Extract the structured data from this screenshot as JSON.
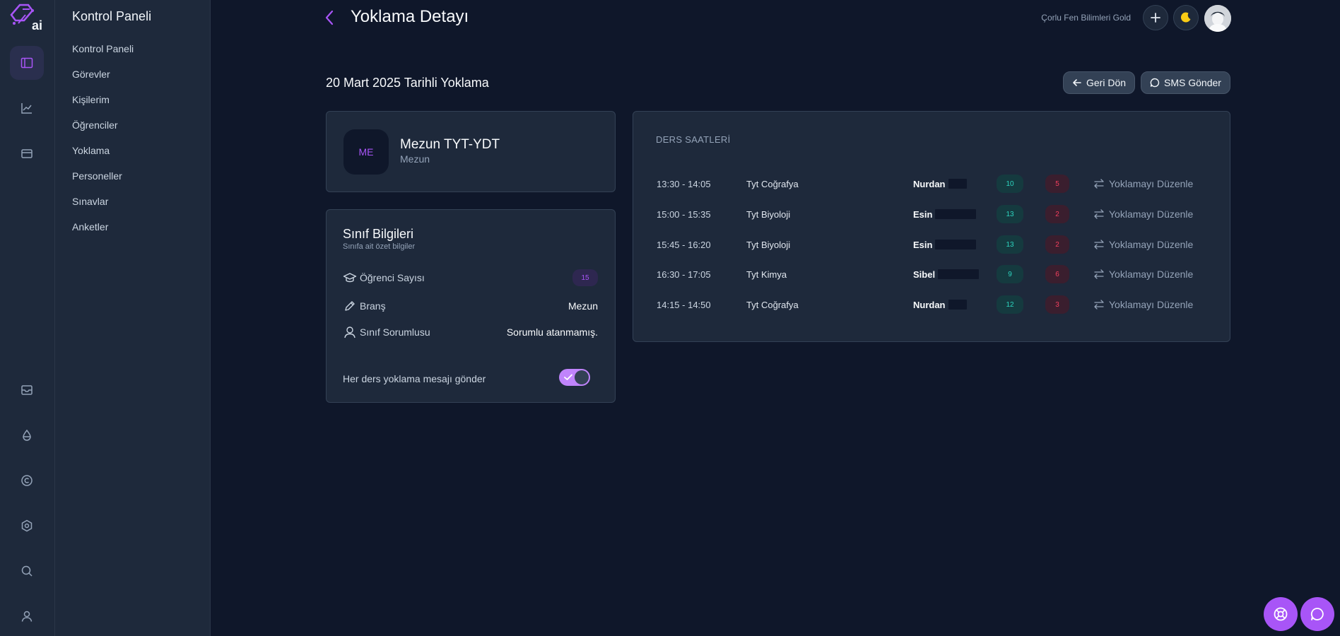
{
  "brand": {
    "logo_text": "ai",
    "accent": "#a855f7"
  },
  "sidebar": {
    "title": "Kontrol Paneli",
    "items": [
      {
        "label": "Kontrol Paneli"
      },
      {
        "label": "Görevler"
      },
      {
        "label": "Kişilerim"
      },
      {
        "label": "Öğrenciler"
      },
      {
        "label": "Yoklama"
      },
      {
        "label": "Personeller"
      },
      {
        "label": "Sınavlar"
      },
      {
        "label": "Anketler"
      }
    ]
  },
  "rail": {
    "icons": [
      "panel-icon",
      "chart-icon",
      "wallet-icon",
      "inbox-icon",
      "drop-icon",
      "copyright-icon",
      "settings-icon",
      "search-icon",
      "user-icon"
    ]
  },
  "header": {
    "title": "Yoklama Detayı",
    "org": "Çorlu Fen Bilimleri Gold"
  },
  "section": {
    "title": "20 Mart 2025 Tarihli Yoklama",
    "back_label": "Geri Dön",
    "sms_label": "SMS Gönder"
  },
  "class_card": {
    "initials": "ME",
    "name": "Mezun TYT-YDT",
    "subtitle": "Mezun"
  },
  "info_card": {
    "title": "Sınıf Bilgileri",
    "subtitle": "Sınıfa ait özet bilgiler",
    "student_count_label": "Öğrenci Sayısı",
    "student_count": "15",
    "branch_label": "Branş",
    "branch": "Mezun",
    "owner_label": "Sınıf Sorumlusu",
    "owner": "Sorumlu atanmamış.",
    "toggle_label": "Her ders yoklama mesajı gönder",
    "toggle_on": true
  },
  "lessons": {
    "label": "DERS SAATLERİ",
    "edit_label": "Yoklamayı Düzenle",
    "rows": [
      {
        "time": "13:30 - 14:05",
        "course": "Tyt Coğrafya",
        "teacher": "Nurdan",
        "present": "10",
        "absent": "5"
      },
      {
        "time": "15:00 - 15:35",
        "course": "Tyt Biyoloji",
        "teacher": "Esin",
        "present": "13",
        "absent": "2"
      },
      {
        "time": "15:45 - 16:20",
        "course": "Tyt Biyoloji",
        "teacher": "Esin",
        "present": "13",
        "absent": "2"
      },
      {
        "time": "16:30 - 17:05",
        "course": "Tyt Kimya",
        "teacher": "Sibel",
        "present": "9",
        "absent": "6"
      },
      {
        "time": "14:15 - 14:50",
        "course": "Tyt Coğrafya",
        "teacher": "Nurdan",
        "present": "12",
        "absent": "3"
      }
    ]
  }
}
